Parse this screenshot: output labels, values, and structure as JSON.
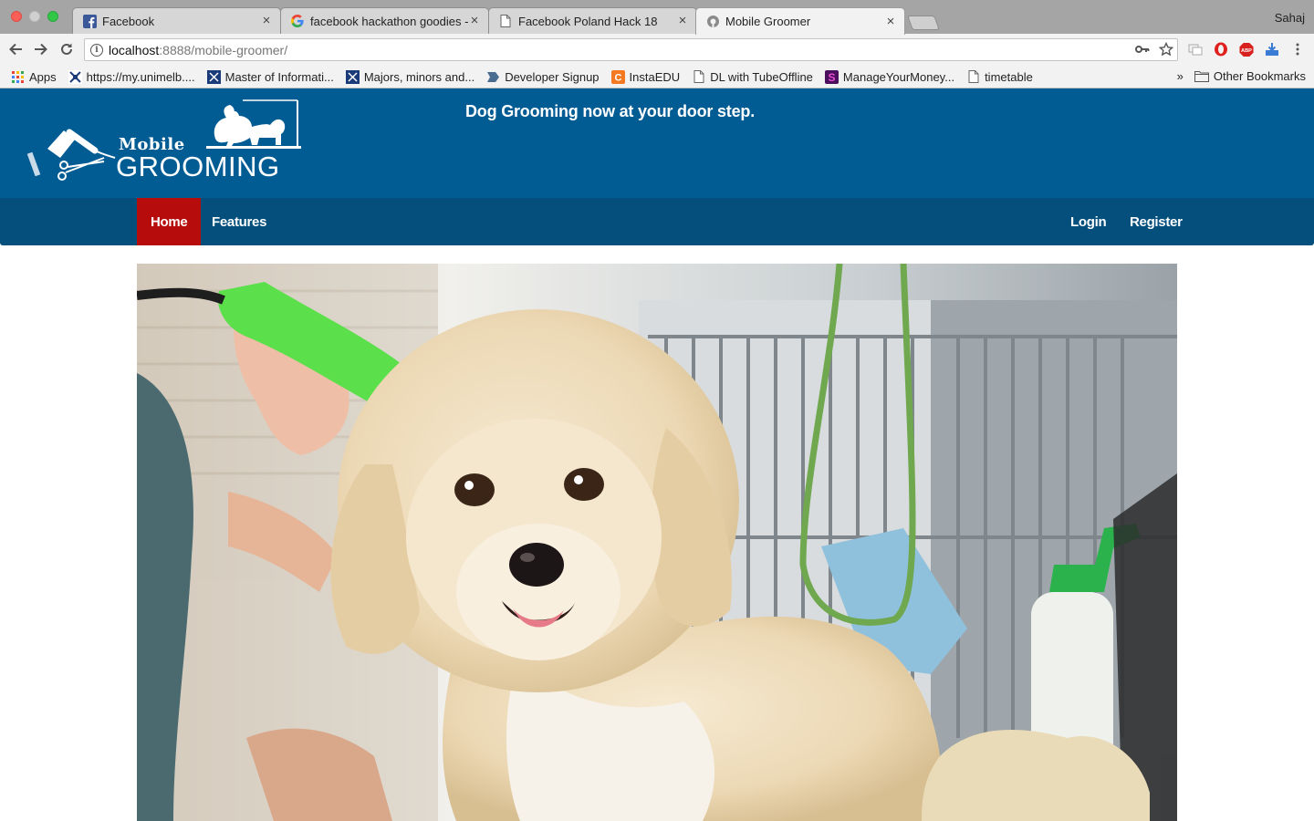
{
  "browser": {
    "tabs": [
      {
        "title": "Facebook",
        "icon": "facebook-icon",
        "active": false
      },
      {
        "title": "facebook hackathon goodies - ",
        "icon": "google-icon",
        "active": false
      },
      {
        "title": "Facebook Poland Hack 18",
        "icon": "page-icon",
        "active": false
      },
      {
        "title": "Mobile Groomer",
        "icon": "globe-icon",
        "active": true
      }
    ],
    "profile_name": "Sahaj",
    "url_host": "localhost",
    "url_path": ":8888/mobile-groomer/",
    "bookmarks": [
      {
        "label": "Apps",
        "icon": "apps-grid-icon"
      },
      {
        "label": "https://my.unimelb....",
        "icon": "unimelb-icon"
      },
      {
        "label": "Master of Informati...",
        "icon": "unimelb-icon"
      },
      {
        "label": "Majors, minors and...",
        "icon": "unimelb-icon"
      },
      {
        "label": "Developer Signup",
        "icon": "developer-icon"
      },
      {
        "label": "InstaEDU",
        "icon": "instaedu-icon"
      },
      {
        "label": "DL with TubeOffline",
        "icon": "page-icon"
      },
      {
        "label": "ManageYourMoney...",
        "icon": "manageyourmoney-icon"
      },
      {
        "label": "timetable",
        "icon": "page-icon"
      }
    ],
    "overflow_label": "»",
    "other_bookmarks": "Other Bookmarks"
  },
  "site": {
    "logo_top": "Mobile",
    "logo_main": "GROOMING",
    "tagline": "Dog Grooming now at your door step.",
    "nav_left": [
      {
        "label": "Home",
        "active": true
      },
      {
        "label": "Features",
        "active": false
      }
    ],
    "nav_right": [
      {
        "label": "Login"
      },
      {
        "label": "Register"
      }
    ]
  },
  "colors": {
    "header_bg": "#025c94",
    "nav_bg": "#044f7c",
    "nav_active": "#b70c0c"
  }
}
